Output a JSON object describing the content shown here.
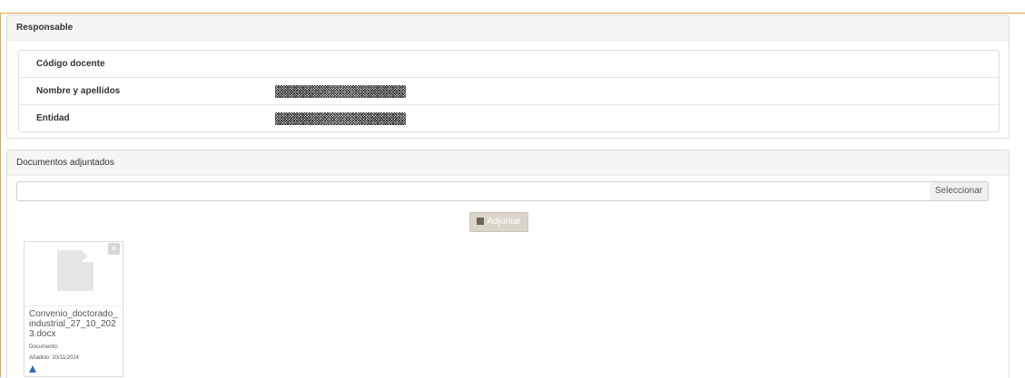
{
  "responsable": {
    "title": "Responsable",
    "rows": [
      {
        "label": "Código docente",
        "value": ""
      },
      {
        "label": "Nombre y apellidos",
        "value": ""
      },
      {
        "label": "Entidad",
        "value": ""
      }
    ]
  },
  "documentos": {
    "title": "Documentos adjuntados",
    "file_input_value": "",
    "select_label": "Seleccionar",
    "attach_label": "Adjuntar",
    "file": {
      "name": "Convenio_doctorado_industrial_27_10_2023.docx",
      "type_label": "Documento:",
      "added_label": "Añadido: 20/11/2024"
    }
  },
  "colors": {
    "accent": "#e8a43a",
    "warning_icon": "#2a6fb5"
  }
}
